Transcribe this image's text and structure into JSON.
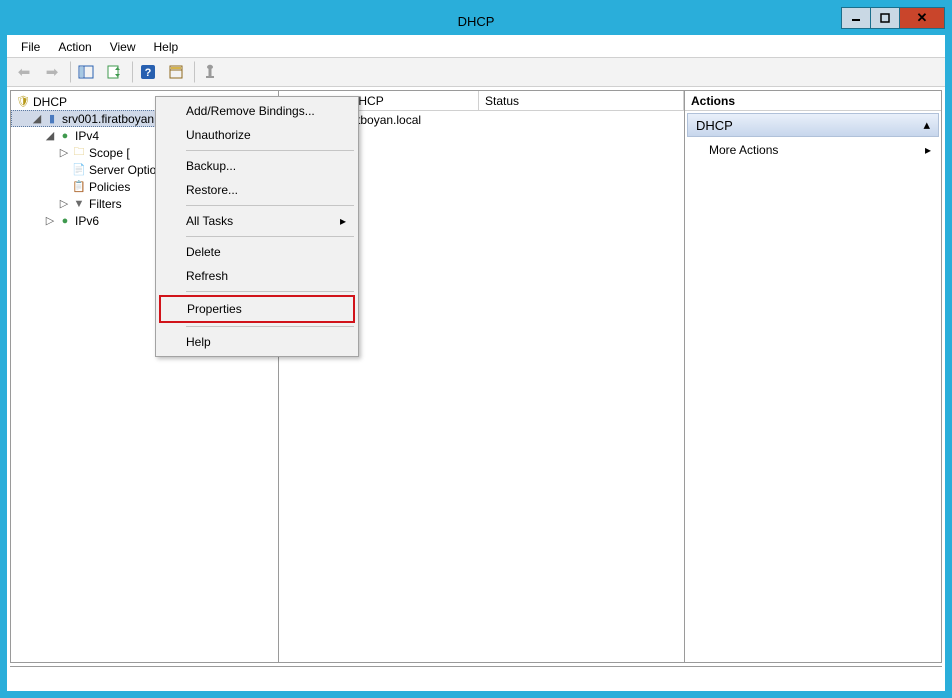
{
  "window": {
    "title": "DHCP"
  },
  "menubar": {
    "items": [
      "File",
      "Action",
      "View",
      "Help"
    ]
  },
  "toolbar": {
    "back": "◄",
    "forward": "►",
    "up": "up",
    "show": "show",
    "refresh": "?",
    "export": "export",
    "help": "help"
  },
  "tree": {
    "root": "DHCP",
    "server": "srv001.firatboyan.local",
    "ipv4": "IPv4",
    "scope": "Scope [",
    "server_options": "Server Options",
    "policies": "Policies",
    "filters": "Filters",
    "ipv6": "IPv6"
  },
  "list": {
    "col_contents": "Contents of DHCP",
    "col_status": "Status",
    "row0": "srv001.firatboyan.local"
  },
  "actions": {
    "title": "Actions",
    "section": "DHCP",
    "more": "More Actions"
  },
  "context_menu": {
    "add_remove_bindings": "Add/Remove Bindings...",
    "unauthorize": "Unauthorize",
    "backup": "Backup...",
    "restore": "Restore...",
    "all_tasks": "All Tasks",
    "delete": "Delete",
    "refresh": "Refresh",
    "properties": "Properties",
    "help": "Help"
  }
}
